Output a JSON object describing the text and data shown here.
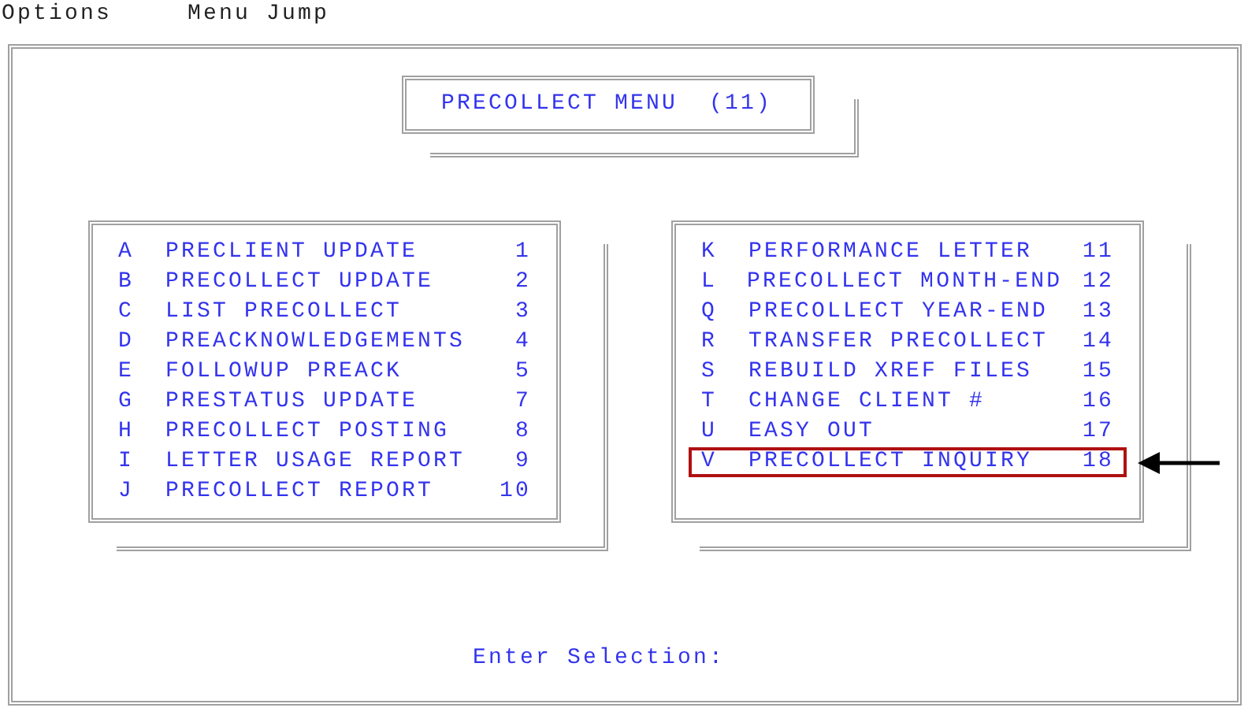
{
  "menu_bar": [
    {
      "label": "Options"
    },
    {
      "label": "Menu Jump"
    }
  ],
  "title": "PRECOLLECT MENU  (11)",
  "panels": [
    {
      "items": [
        {
          "key": "A",
          "label": "PRECLIENT UPDATE",
          "number": "1",
          "highlighted": false
        },
        {
          "key": "B",
          "label": "PRECOLLECT UPDATE",
          "number": "2",
          "highlighted": false
        },
        {
          "key": "C",
          "label": "LIST PRECOLLECT",
          "number": "3",
          "highlighted": false
        },
        {
          "key": "D",
          "label": "PREACKNOWLEDGEMENTS",
          "number": "4",
          "highlighted": false
        },
        {
          "key": "E",
          "label": "FOLLOWUP PREACK",
          "number": "5",
          "highlighted": false
        },
        {
          "key": "G",
          "label": "PRESTATUS UPDATE",
          "number": "7",
          "highlighted": false
        },
        {
          "key": "H",
          "label": "PRECOLLECT POSTING",
          "number": "8",
          "highlighted": false
        },
        {
          "key": "I",
          "label": "LETTER USAGE REPORT",
          "number": "9",
          "highlighted": false
        },
        {
          "key": "J",
          "label": "PRECOLLECT REPORT",
          "number": "10",
          "highlighted": false
        }
      ]
    },
    {
      "items": [
        {
          "key": "K",
          "label": "PERFORMANCE LETTER",
          "number": "11",
          "highlighted": false
        },
        {
          "key": "L",
          "label": "PRECOLLECT MONTH-END",
          "number": "12",
          "highlighted": false
        },
        {
          "key": "Q",
          "label": "PRECOLLECT YEAR-END",
          "number": "13",
          "highlighted": false
        },
        {
          "key": "R",
          "label": "TRANSFER PRECOLLECT",
          "number": "14",
          "highlighted": false
        },
        {
          "key": "S",
          "label": "REBUILD XREF FILES",
          "number": "15",
          "highlighted": false
        },
        {
          "key": "T",
          "label": "CHANGE CLIENT #",
          "number": "16",
          "highlighted": false
        },
        {
          "key": "U",
          "label": "EASY OUT",
          "number": "17",
          "highlighted": false
        },
        {
          "key": "V",
          "label": "PRECOLLECT INQUIRY",
          "number": "18",
          "highlighted": true
        }
      ]
    }
  ],
  "prompt": "Enter Selection:"
}
